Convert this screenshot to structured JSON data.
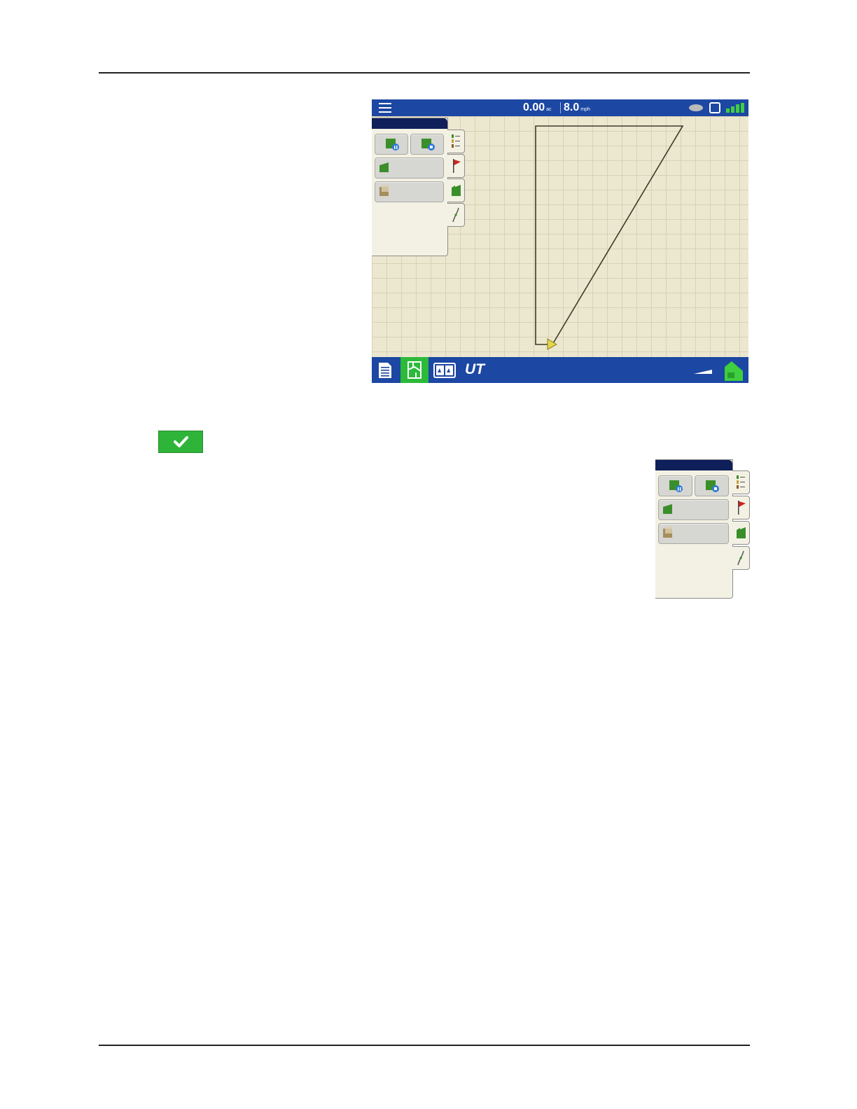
{
  "status_bar": {
    "area_value": "0.00",
    "area_unit": "ac",
    "speed_value": "8.0",
    "speed_unit": "mph"
  },
  "icons": {
    "menu": "hamburger-menu-icon",
    "gps": "satellite-icon",
    "display": "display-icon",
    "signal": "signal-icon",
    "accept": "checkmark-icon"
  },
  "bottom_bar": {
    "ut_label": "UT"
  },
  "colors": {
    "bar_blue": "#1c47a3",
    "panel_header": "#0f1f5a",
    "active_green": "#2cba3a",
    "map_background": "#ece7cf"
  }
}
